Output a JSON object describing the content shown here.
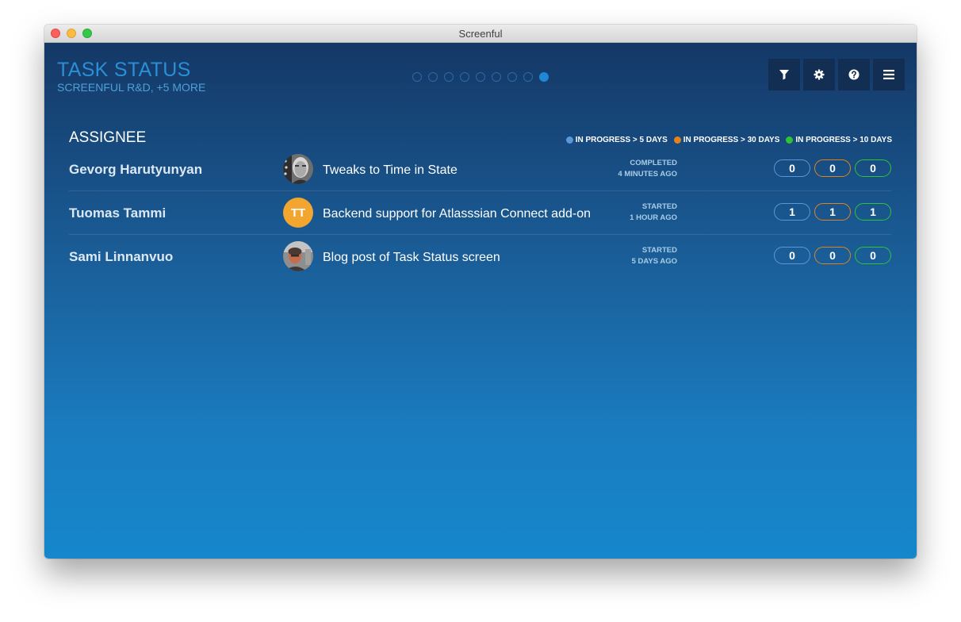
{
  "window": {
    "title": "Screenful"
  },
  "header": {
    "title": "TASK STATUS",
    "subtitle": "SCREENFUL R&D, +5 MORE"
  },
  "pagination": {
    "total": 9,
    "active_index": 8
  },
  "toolbar": [
    {
      "name": "filter",
      "icon": "filter-icon"
    },
    {
      "name": "settings",
      "icon": "gear-icon"
    },
    {
      "name": "help",
      "icon": "question-icon"
    },
    {
      "name": "menu",
      "icon": "hamburger-icon"
    }
  ],
  "section": {
    "title": "ASSIGNEE"
  },
  "colors": {
    "blue": "#5b97d6",
    "orange": "#e2821e",
    "green": "#2fc436"
  },
  "legend": [
    {
      "label": "IN PROGRESS > 5 DAYS",
      "color": "#5b97d6"
    },
    {
      "label": "IN PROGRESS > 30 DAYS",
      "color": "#e2821e"
    },
    {
      "label": "IN PROGRESS > 10 DAYS",
      "color": "#2fc436"
    }
  ],
  "rows": [
    {
      "assignee": "Gevorg Harutyunyan",
      "avatar": "photo",
      "task": "Tweaks to Time in State",
      "status": "COMPLETED",
      "time": "4 MINUTES AGO",
      "counts": [
        "0",
        "0",
        "0"
      ]
    },
    {
      "assignee": "Tuomas Tammi",
      "avatar": "TT",
      "task": "Backend support for Atlasssian Connect add-on",
      "status": "STARTED",
      "time": "1 HOUR AGO",
      "counts": [
        "1",
        "1",
        "1"
      ]
    },
    {
      "assignee": "Sami Linnanvuo",
      "avatar": "photo",
      "task": "Blog post of Task Status screen",
      "status": "STARTED",
      "time": "5 DAYS AGO",
      "counts": [
        "0",
        "0",
        "0"
      ]
    }
  ]
}
